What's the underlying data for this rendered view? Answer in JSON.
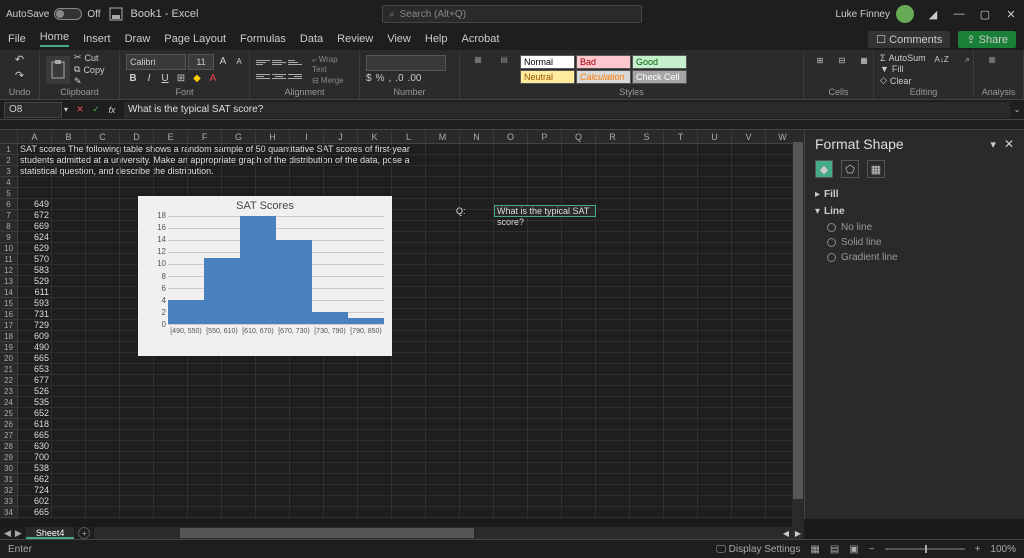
{
  "titlebar": {
    "autosave_label": "AutoSave",
    "autosave_state": "Off",
    "doc_name": "Book1 - Excel",
    "search_placeholder": "Search (Alt+Q)",
    "user_name": "Luke Finney"
  },
  "tabs": {
    "file": "File",
    "home": "Home",
    "insert": "Insert",
    "draw": "Draw",
    "page_layout": "Page Layout",
    "formulas": "Formulas",
    "data": "Data",
    "review": "Review",
    "view": "View",
    "help": "Help",
    "acrobat": "Acrobat",
    "comments": "Comments",
    "share": "Share"
  },
  "ribbon": {
    "undo": "Undo",
    "clipboard": "Clipboard",
    "cut": "Cut",
    "copy": "Copy",
    "font_label": "Font",
    "font_name": "Calibri",
    "font_size": "11",
    "alignment": "Alignment",
    "number": "Number",
    "styles": "Styles",
    "style_normal": "Normal",
    "style_bad": "Bad",
    "style_good": "Good",
    "style_neutral": "Neutral",
    "style_calc": "Calculation",
    "style_check": "Check Cell",
    "cells": "Cells",
    "editing": "Editing",
    "autosum": "AutoSum",
    "fill": "Fill",
    "clear": "Clear",
    "sort": "Sort & Filter",
    "find": "Find & Select",
    "analysis": "Analysis"
  },
  "formula_bar": {
    "cell_ref": "O8",
    "formula": "What is the typical SAT score?"
  },
  "columns": [
    "A",
    "B",
    "C",
    "D",
    "E",
    "F",
    "G",
    "H",
    "I",
    "J",
    "K",
    "L",
    "M",
    "N",
    "O",
    "P",
    "Q",
    "R",
    "S",
    "T",
    "U",
    "V",
    "W"
  ],
  "text_row1": "SAT scores The following table shows a random sample of 50 quantitative SAT scores of first-year",
  "text_row2": "students admitted at a university. Make an appropriate graph of the distribution of the data, pose a",
  "text_row3": "statistical question, and describe the distribution.",
  "q_label": "Q:",
  "q_text": "What is the typical SAT score?",
  "col_a_values": [
    "649",
    "672",
    "669",
    "624",
    "629",
    "570",
    "583",
    "529",
    "611",
    "593",
    "731",
    "729",
    "609",
    "490",
    "665",
    "653",
    "677",
    "526",
    "535",
    "652",
    "618",
    "665",
    "630",
    "700",
    "538",
    "662",
    "724",
    "602",
    "665"
  ],
  "chart_data": {
    "type": "bar",
    "title": "SAT Scores",
    "categories": [
      "[490, 550)",
      "[550, 610)",
      "[610, 670)",
      "[670, 730)",
      "[730, 790)",
      "[790, 850)"
    ],
    "values": [
      4,
      11,
      18,
      14,
      2,
      1
    ],
    "ylim": [
      0,
      18
    ],
    "yticks": [
      "18",
      "16",
      "14",
      "12",
      "10",
      "8",
      "6",
      "4",
      "2",
      "0"
    ]
  },
  "pane": {
    "title": "Format Shape",
    "fill": "Fill",
    "line": "Line",
    "no_line": "No line",
    "solid_line": "Solid line",
    "gradient_line": "Gradient line"
  },
  "sheet_tabs": {
    "sheet4": "Sheet4"
  },
  "status": {
    "mode": "Enter",
    "display_settings": "Display Settings",
    "zoom": "100%"
  }
}
